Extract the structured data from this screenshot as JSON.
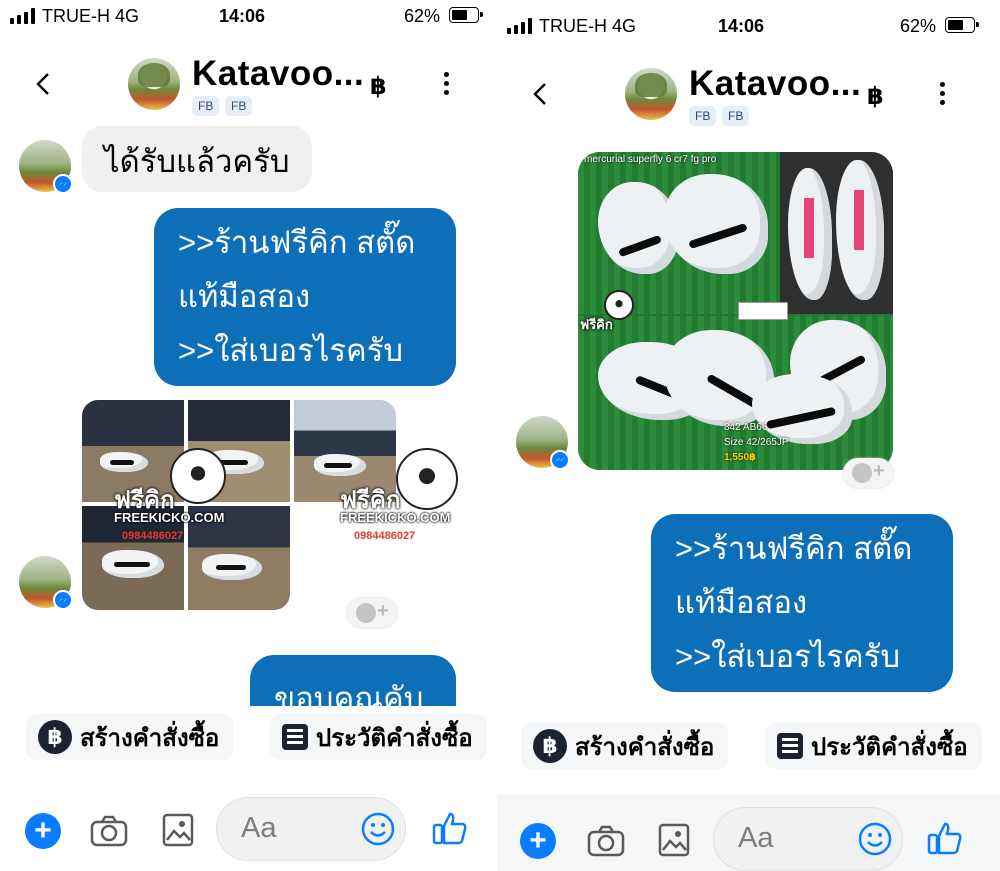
{
  "screens": {
    "left": {
      "status": {
        "carrier": "TRUE-H  4G",
        "time": "14:06",
        "battery": "62%"
      },
      "header": {
        "name": "Katavoo...",
        "currency": "฿",
        "badges": [
          "FB",
          "FB"
        ]
      },
      "messages": {
        "received_text": "ได้รับแล้วครับ",
        "sent_lines": [
          ">>ร้านฟรีคิก สตั๊ด",
          "แท้มือสอง",
          ">>ใส่เบอรไรครับ"
        ],
        "partial_text": "ขอบคุณคับ"
      },
      "watermark": {
        "brand": "ฟรีคิก",
        "site": "FREEKICKO.COM",
        "phone": "0984486027"
      }
    },
    "right": {
      "status": {
        "carrier": "TRUE-H  4G",
        "time": "14:06",
        "battery": "62%"
      },
      "header": {
        "name": "Katavoo...",
        "currency": "฿",
        "badges": [
          "FB",
          "FB"
        ]
      },
      "image_caption": "mercurial superfly 6 cr7 fg pro",
      "image_info": [
        "842 AB66",
        "Size 42/265JP",
        "1,550฿"
      ],
      "image_brand": "ฟรีคิก",
      "messages": {
        "sent_lines": [
          ">>ร้านฟรีคิก สตั๊ด",
          "แท้มือสอง",
          ">>ใส่เบอรไรครับ"
        ]
      }
    }
  },
  "actions": {
    "create_order": "สร้างคำสั่งซื้อ",
    "order_history": "ประวัติคำสั่งซื้อ",
    "baht_symbol": "฿"
  },
  "composer": {
    "placeholder": "Aa"
  },
  "colors": {
    "bubble_out": "#0d6fb8",
    "messenger_blue": "#0a7cff",
    "bubble_in": "#f1f0f0"
  },
  "icons": [
    "back-icon",
    "more-icon",
    "plus-icon",
    "camera-icon",
    "image-icon",
    "emoji-icon",
    "like-icon",
    "messenger-icon",
    "react-icon",
    "baht-icon",
    "list-icon"
  ]
}
